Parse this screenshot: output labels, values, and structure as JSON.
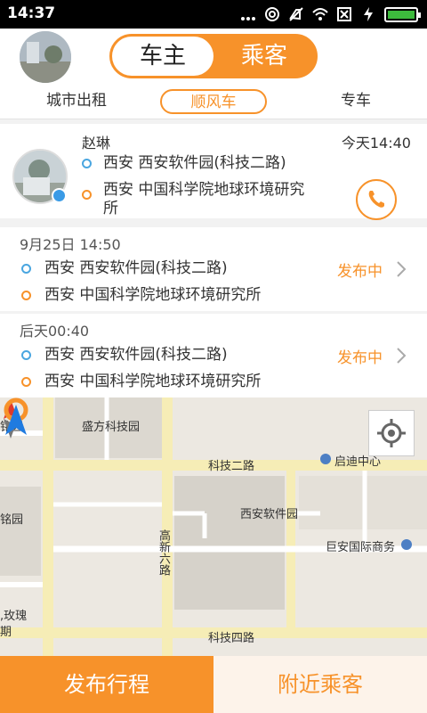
{
  "status_bar": {
    "time": "14:37",
    "icons": [
      "signal-dots-icon",
      "alarm-icon",
      "mute-icon",
      "wifi-icon",
      "sim-off-icon",
      "charging-icon",
      "battery-icon"
    ]
  },
  "header": {
    "role_toggle": {
      "owner": "车主",
      "passenger": "乘客",
      "selected": "车主"
    }
  },
  "service_tabs": {
    "items": [
      "城市出租",
      "顺风车",
      "专车"
    ],
    "selected": "顺风车"
  },
  "current_order": {
    "name": "赵琳",
    "time": "今天14:40",
    "from": "西安 西安软件园(科技二路)",
    "to_line1": "西安 中国科学院地球环境研究",
    "to_line2": "所"
  },
  "trips": [
    {
      "date": "9月25日 14:50",
      "from": "西安 西安软件园(科技二路)",
      "to": "西安 中国科学院地球环境研究所",
      "status": "发布中"
    },
    {
      "date": "后天00:40",
      "from": "西安 西安软件园(科技二路)",
      "to": "西安 中国科学院地球环境研究所",
      "status": "发布中"
    }
  ],
  "map": {
    "labels": {
      "ming_yuan_top": "铭园",
      "sheng_fang": "盛方科技园",
      "keji_er_lu": "科技二路",
      "qidi": "启迪中心",
      "ming_yuan": "铭园",
      "xian_software_park": "西安软件园",
      "gaoxin_liu_lu": "高新六路",
      "ju_an": "巨安国际商务",
      "rose": ",玫瑰",
      "rose_2": "期",
      "keji_si_lu": "科技四路"
    }
  },
  "bottom_bar": {
    "publish": "发布行程",
    "nearby": "附近乘客"
  },
  "colors": {
    "accent": "#f7922a",
    "start_dot": "#4aa6e0",
    "end_dot": "#f7922a"
  }
}
